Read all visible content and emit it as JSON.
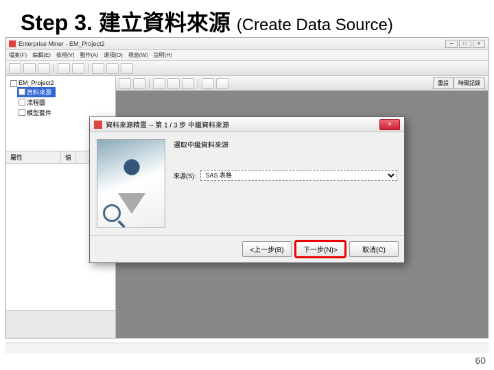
{
  "slide": {
    "step": "Step 3.",
    "title_zh": "建立資料來源",
    "title_en": "(Create Data Source)",
    "page": "60"
  },
  "app": {
    "title": "Enterprise Miner - EM_Project2",
    "menu": [
      "檔案(F)",
      "編輯(E)",
      "檢視(V)",
      "動作(A)",
      "選項(O)",
      "視窗(W)",
      "說明(H)"
    ],
    "tree": {
      "root": "EM_Project2",
      "items": [
        "資料來源",
        "流程圖",
        "模型套件"
      ]
    },
    "props": {
      "col1": "屬性",
      "col2": "值"
    },
    "canvas_tabs": [
      "重設",
      "時間記錄"
    ]
  },
  "dialog": {
    "title": "資料來源精靈 -- 第 1 / 3 步 中繼資料來源",
    "heading": "選取中繼資料來源",
    "field_label": "來源(S):",
    "field_value": "SAS 表格",
    "buttons": {
      "back": "<上一步(B)",
      "next": "下一步(N)>",
      "cancel": "取消(C)"
    }
  }
}
